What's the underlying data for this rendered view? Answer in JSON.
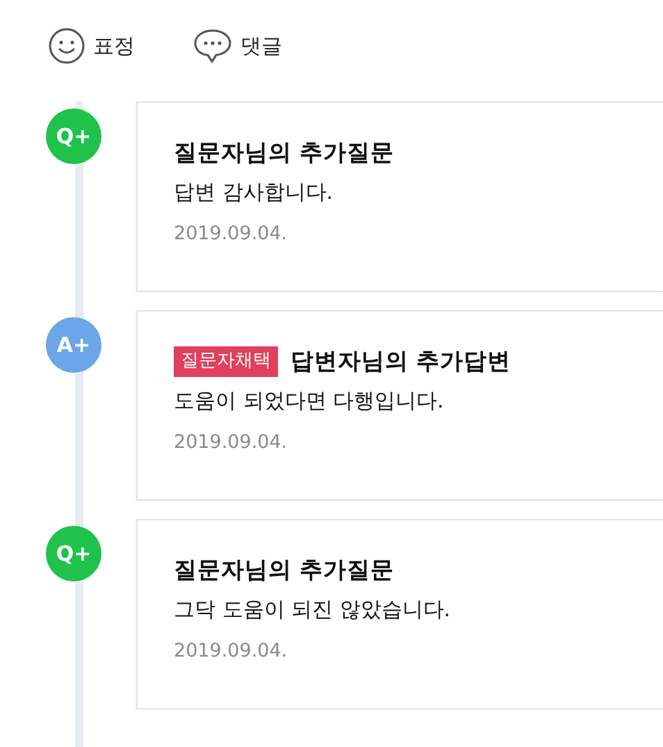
{
  "actions": [
    {
      "kind": "emoji",
      "label": "표정"
    },
    {
      "kind": "comment",
      "label": "댓글"
    }
  ],
  "posts": [
    {
      "kind": "question",
      "marker": "Q+",
      "title": "질문자님의 추가질문",
      "body": "답변 감사합니다.",
      "date": "2019.09.04."
    },
    {
      "kind": "answer",
      "marker": "A+",
      "badge": "질문자채택",
      "title": "답변자님의 추가답변",
      "body": "도움이 되었다면 다행입니다.",
      "date": "2019.09.04."
    },
    {
      "kind": "question",
      "marker": "Q+",
      "title": "질문자님의 추가질문",
      "body": "그닥 도움이 되진 않았습니다.",
      "date": "2019.09.04."
    }
  ]
}
